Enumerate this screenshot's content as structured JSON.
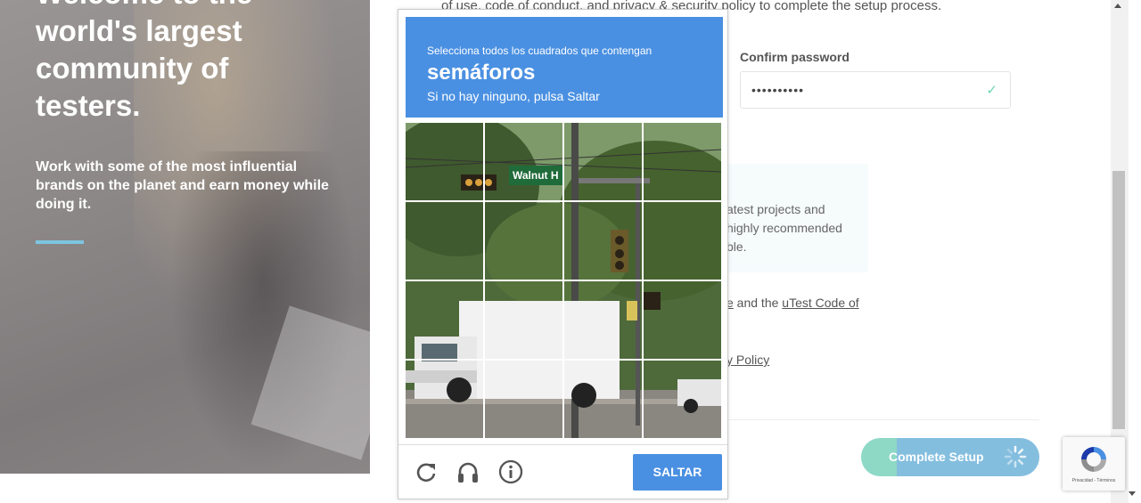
{
  "hero": {
    "heading": "Welcome to the world's largest community of testers.",
    "subtext": "Work with some of the most influential brands on the planet and earn money while doing it."
  },
  "form": {
    "intro": "of use, code of conduct, and privacy & security policy to complete the setup process.",
    "confirm_password_label": "Confirm password",
    "confirm_password_value": "••••••••••",
    "info_line1": "atest projects and",
    "info_line2": "highly recommended",
    "info_line3": "ble.",
    "agree_prefix": "e",
    "agree_mid": " and the ",
    "agree_link": "uTest Code of",
    "privacy_link": "y Policy",
    "complete_button": "Complete Setup"
  },
  "captcha": {
    "instruction": "Selecciona todos los cuadrados que contengan",
    "keyword": "semáforos",
    "hint": "Si no hay ninguno, pulsa Saltar",
    "skip_label": "SALTAR",
    "street_sign": "Walnut H"
  },
  "recaptcha_badge": {
    "terms": "Privacidad - Términos"
  },
  "colors": {
    "captcha_blue": "#4a90e2",
    "setup_teal": "#8ed8c6",
    "setup_blue": "#84bedf",
    "check_green": "#6fd6b0",
    "accent_line": "#7cc6e0"
  }
}
